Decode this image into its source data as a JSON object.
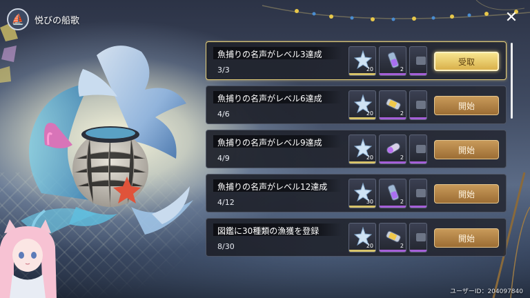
{
  "header": {
    "title": "悦びの船歌",
    "icon": "boat-emblem-icon"
  },
  "close_icon": "close-icon",
  "quests": [
    {
      "title": "魚捕りの名声がレベル3達成",
      "progress": "3/3",
      "action": "受取",
      "state": "claimable",
      "rewards": [
        {
          "icon": "star-crystal-icon",
          "qty": "20",
          "rarity": "gold"
        },
        {
          "icon": "potion-vial-icon",
          "qty": "2",
          "rarity": "purple"
        },
        {
          "icon": "material-icon",
          "qty": "",
          "rarity": "purple"
        }
      ]
    },
    {
      "title": "魚捕りの名声がレベル6達成",
      "progress": "4/6",
      "action": "開始",
      "state": "in-progress",
      "rewards": [
        {
          "icon": "star-crystal-icon",
          "qty": "20",
          "rarity": "gold"
        },
        {
          "icon": "battery-capsule-icon",
          "qty": "2",
          "rarity": "purple"
        },
        {
          "icon": "material-icon",
          "qty": "",
          "rarity": "purple"
        }
      ]
    },
    {
      "title": "魚捕りの名声がレベル9達成",
      "progress": "4/9",
      "action": "開始",
      "state": "in-progress",
      "rewards": [
        {
          "icon": "star-crystal-icon",
          "qty": "20",
          "rarity": "gold"
        },
        {
          "icon": "capsule-vial-icon",
          "qty": "2",
          "rarity": "purple"
        },
        {
          "icon": "material-icon",
          "qty": "",
          "rarity": "purple"
        }
      ]
    },
    {
      "title": "魚捕りの名声がレベル12達成",
      "progress": "4/12",
      "action": "開始",
      "state": "in-progress",
      "rewards": [
        {
          "icon": "star-crystal-icon",
          "qty": "30",
          "rarity": "gold"
        },
        {
          "icon": "potion-vial-icon",
          "qty": "2",
          "rarity": "purple"
        },
        {
          "icon": "material-icon",
          "qty": "",
          "rarity": "purple"
        }
      ]
    },
    {
      "title": "図鑑に30種類の漁獲を登録",
      "progress": "8/30",
      "action": "開始",
      "state": "in-progress",
      "rewards": [
        {
          "icon": "star-crystal-icon",
          "qty": "20",
          "rarity": "gold"
        },
        {
          "icon": "battery-capsule-icon",
          "qty": "2",
          "rarity": "purple"
        },
        {
          "icon": "material-icon",
          "qty": "",
          "rarity": "purple"
        }
      ]
    }
  ],
  "footer": {
    "user_id": "ユーザーID：204097840"
  },
  "colors": {
    "claim_button": "#e9c860",
    "start_button": "#b3844a",
    "gold_rarity": "#d8c46a",
    "purple_rarity": "#a55fd8"
  }
}
